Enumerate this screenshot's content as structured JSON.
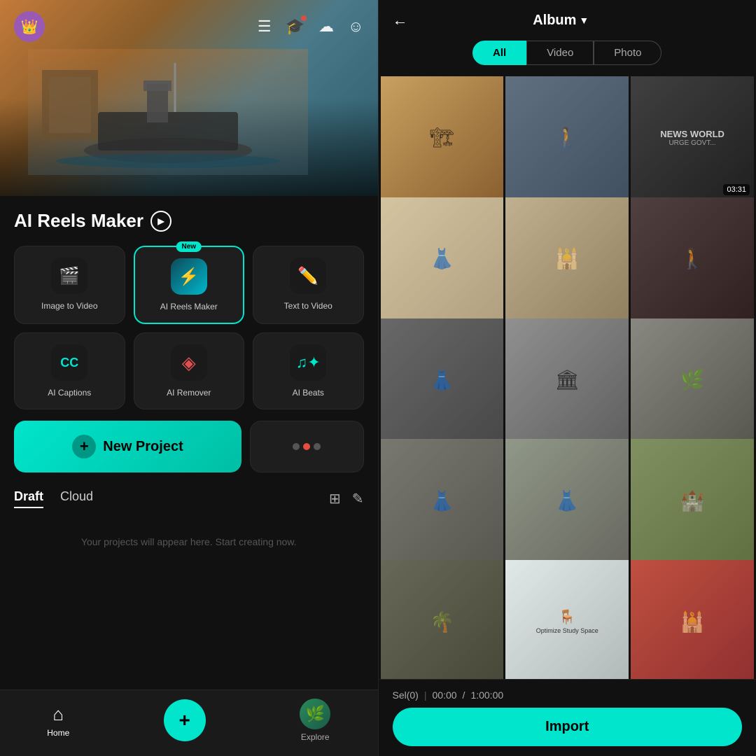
{
  "left": {
    "hero_alt": "Harbor scene with ship",
    "top_bar": {
      "crown_emoji": "👑",
      "icons": [
        "≡",
        "🎓",
        "☁",
        "☺"
      ]
    },
    "section_title": "AI Reels Maker",
    "tools": [
      {
        "id": "image-to-video",
        "label": "Image to Video",
        "icon": "🎬",
        "style": "dark",
        "new": false,
        "highlighted": false
      },
      {
        "id": "ai-reels-maker",
        "label": "AI Reels Maker",
        "icon": "⚡",
        "style": "teal",
        "new": true,
        "highlighted": true
      },
      {
        "id": "text-to-video",
        "label": "Text to Video",
        "icon": "✏️",
        "style": "dark",
        "new": false,
        "highlighted": false
      },
      {
        "id": "ai-captions",
        "label": "AI Captions",
        "icon": "CC",
        "style": "dark",
        "new": false,
        "highlighted": false
      },
      {
        "id": "ai-remover",
        "label": "AI Remover",
        "icon": "◈",
        "style": "dark",
        "new": false,
        "highlighted": false
      },
      {
        "id": "ai-beats",
        "label": "AI Beats",
        "icon": "🎵",
        "style": "dark",
        "new": false,
        "highlighted": false
      }
    ],
    "new_project_label": "New Project",
    "new_badge_label": "New",
    "tabs": [
      {
        "id": "draft",
        "label": "Draft",
        "active": true
      },
      {
        "id": "cloud",
        "label": "Cloud",
        "active": false
      }
    ],
    "empty_message": "Your projects will appear here. Start creating now.",
    "nav": {
      "home_label": "Home",
      "explore_label": "Explore"
    }
  },
  "right": {
    "back_label": "←",
    "title": "Album",
    "chevron": "▼",
    "filters": [
      {
        "id": "all",
        "label": "All",
        "active": true
      },
      {
        "id": "video",
        "label": "Video",
        "active": false
      },
      {
        "id": "photo",
        "label": "Photo",
        "active": false
      }
    ],
    "photos": [
      {
        "id": 1,
        "style": "p1",
        "emoji": "🏗",
        "duration": null
      },
      {
        "id": 2,
        "style": "p2",
        "emoji": "👤",
        "duration": null
      },
      {
        "id": 3,
        "style": "p3",
        "emoji": "📰",
        "duration": "03:31"
      },
      {
        "id": 4,
        "style": "p4",
        "emoji": "👗",
        "duration": null
      },
      {
        "id": 5,
        "style": "p5",
        "emoji": "🕌",
        "duration": null
      },
      {
        "id": 6,
        "style": "p6",
        "emoji": "🚶",
        "duration": null
      },
      {
        "id": 7,
        "style": "p7",
        "emoji": "👗",
        "duration": null
      },
      {
        "id": 8,
        "style": "p8",
        "emoji": "🏛",
        "duration": null
      },
      {
        "id": 9,
        "style": "p9",
        "emoji": "🌿",
        "duration": null
      },
      {
        "id": 10,
        "style": "p10",
        "emoji": "👗",
        "duration": null
      },
      {
        "id": 11,
        "style": "p11",
        "emoji": "👗",
        "duration": null
      },
      {
        "id": 12,
        "style": "p12",
        "emoji": "🏰",
        "duration": null
      },
      {
        "id": 13,
        "style": "p13",
        "emoji": "🌴",
        "duration": null
      },
      {
        "id": 14,
        "style": "p14",
        "emoji": "🪑",
        "duration": null
      },
      {
        "id": 15,
        "style": "p15",
        "emoji": "🕌",
        "duration": null
      }
    ],
    "footer": {
      "sel_label": "Sel(0)",
      "time_current": "00:00",
      "time_divider": "/",
      "time_limit": "1:00:00",
      "import_label": "Import"
    }
  }
}
